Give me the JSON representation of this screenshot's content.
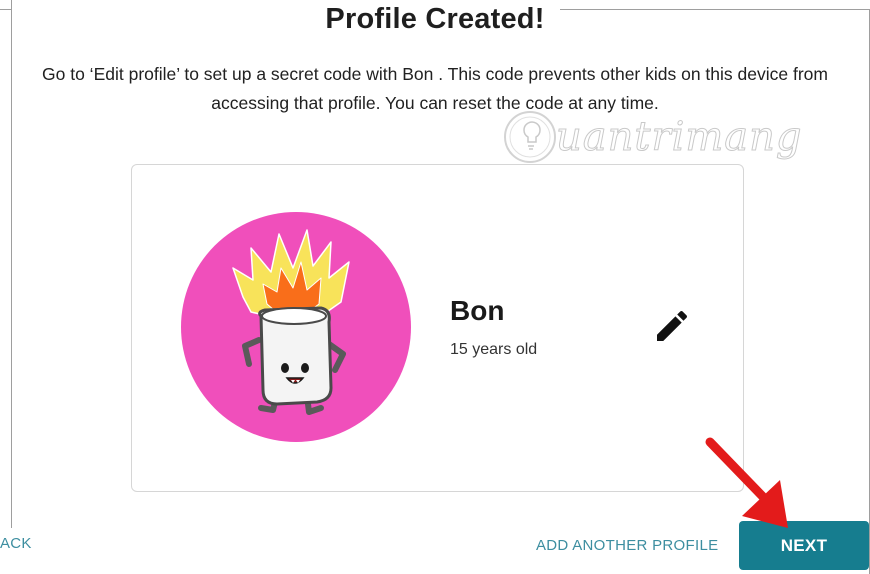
{
  "header": {
    "title": "Profile Created!"
  },
  "description": "Go to ‘Edit profile’ to set up a secret code with Bon . This code prevents other kids on this device from accessing that profile. You can reset the code at any time.",
  "watermark": {
    "text": "uantrimang"
  },
  "profile_card": {
    "avatar": "marshmallow-character-avatar",
    "name": "Bon",
    "age": "15 years old",
    "edit_icon": "pencil-icon"
  },
  "footer": {
    "back_label": "ACK",
    "add_profile_label": "ADD ANOTHER PROFILE",
    "next_label": "NEXT"
  },
  "colors": {
    "accent": "#167d8f",
    "link": "#3d8ea0",
    "avatar_bg": "#f04fbb",
    "annotation_arrow": "#e31b1b"
  }
}
